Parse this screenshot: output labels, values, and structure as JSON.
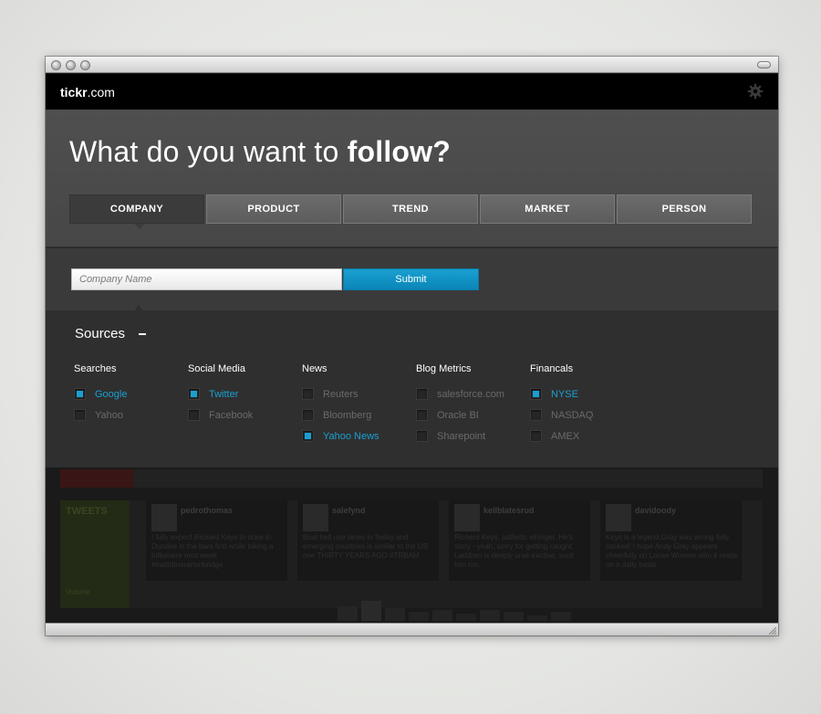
{
  "app": {
    "logo_bold": "tickr",
    "logo_rest": ".com"
  },
  "hero": {
    "headline_regular": "What do you want to",
    "headline_bold": "follow?"
  },
  "tabs": [
    {
      "label": "COMPANY",
      "active": true
    },
    {
      "label": "PRODUCT",
      "active": false
    },
    {
      "label": "TREND",
      "active": false
    },
    {
      "label": "MARKET",
      "active": false
    },
    {
      "label": "PERSON",
      "active": false
    }
  ],
  "search": {
    "placeholder": "Company Name",
    "value": "",
    "submit_label": "Submit"
  },
  "sources": {
    "title": "Sources",
    "collapse_symbol": "–",
    "columns": [
      {
        "title": "Searches",
        "items": [
          {
            "label": "Google",
            "checked": true
          },
          {
            "label": "Yahoo",
            "checked": false
          }
        ]
      },
      {
        "title": "Social Media",
        "items": [
          {
            "label": "Twitter",
            "checked": true
          },
          {
            "label": "Facebook",
            "checked": false
          }
        ]
      },
      {
        "title": "News",
        "items": [
          {
            "label": "Reuters",
            "checked": false
          },
          {
            "label": "Bloomberg",
            "checked": false
          },
          {
            "label": "Yahoo News",
            "checked": true
          }
        ]
      },
      {
        "title": "Blog Metrics",
        "items": [
          {
            "label": "salesforce.com",
            "checked": false
          },
          {
            "label": "Oracle BI",
            "checked": false
          },
          {
            "label": "Sharepoint",
            "checked": false
          }
        ]
      },
      {
        "title": "Financals",
        "items": [
          {
            "label": "NYSE",
            "checked": true
          },
          {
            "label": "NASDAQ",
            "checked": false
          },
          {
            "label": "AMEX",
            "checked": false
          }
        ]
      }
    ]
  },
  "background_dashboard": {
    "tweets_title": "TWEETS",
    "tweets_footer": "Volume",
    "tweets": [
      {
        "user": "pedrothomas",
        "text": "I fully expect Richard Keys to draw in Dundee in the bars first while taking a billionaire next week #mattdmaranunbridge"
      },
      {
        "user": "salefynd",
        "text": "Boat belt use lanes in Today and emerging countries is similar to the US one THIRTY YEARS AGO #TRBAM"
      },
      {
        "user": "kellblatesrud",
        "text": "Richard Keys, pathetic whinger. He's sorry - yeah, sorry for getting caught. Laddism is deeply unat-tractive, suck him too."
      },
      {
        "user": "davidoody",
        "text": "Keys is a legend,Gray was wrong fully sacked! I hope Andy Gray appears cheerfully on Loose Women who it reeds on a daily basis"
      }
    ]
  },
  "colors": {
    "accent": "#1a9fd1",
    "topbar": "#000000",
    "panel": "#4b4b4b",
    "sources_bg": "#2f2f2f"
  },
  "icons": {
    "settings": "gear-icon",
    "collapse": "minus-icon"
  }
}
